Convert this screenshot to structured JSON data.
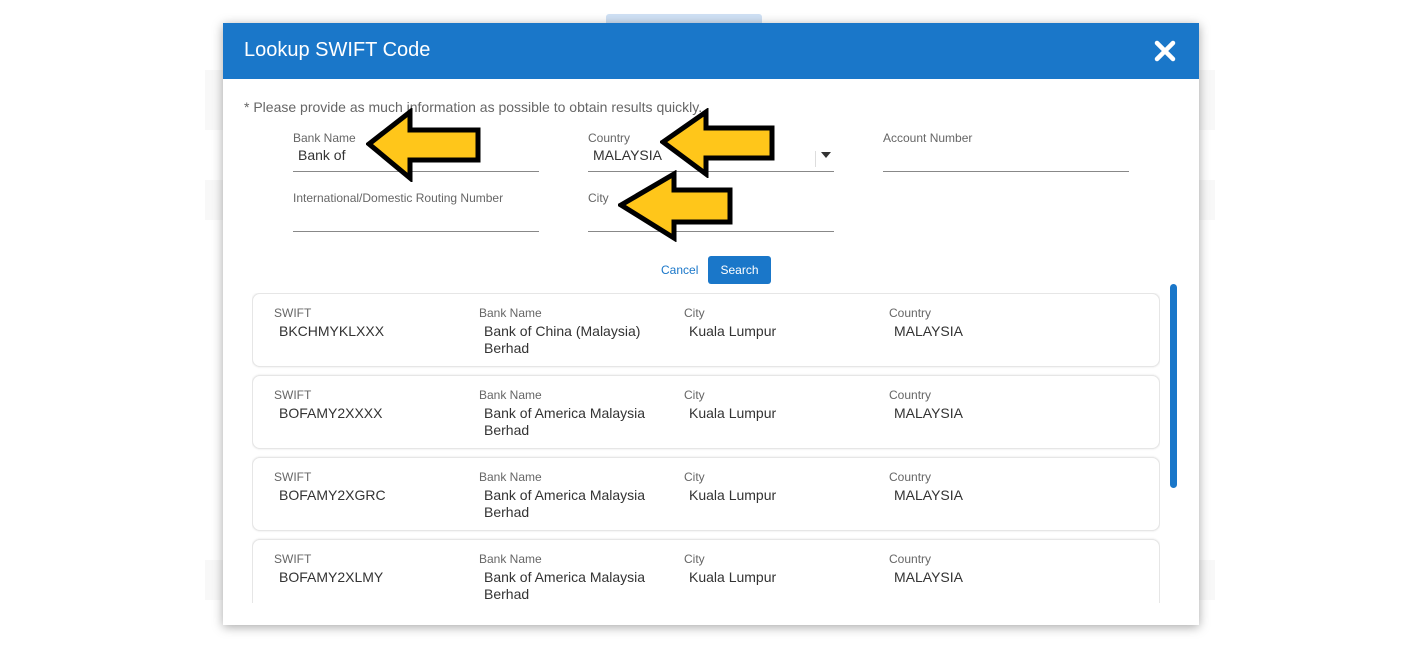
{
  "modal": {
    "title": "Lookup SWIFT Code",
    "hint": "* Please provide as much information as possible to obtain results quickly.",
    "fields": {
      "bank_name": {
        "label": "Bank Name",
        "value": "Bank of"
      },
      "country": {
        "label": "Country",
        "value": "MALAYSIA"
      },
      "account_number": {
        "label": "Account Number",
        "value": ""
      },
      "routing_number": {
        "label": "International/Domestic Routing Number",
        "value": ""
      },
      "city": {
        "label": "City",
        "value": ""
      }
    },
    "cancel_label": "Cancel",
    "search_label": "Search",
    "column_labels": {
      "swift": "SWIFT",
      "bank_name": "Bank Name",
      "city": "City",
      "country": "Country"
    },
    "results": [
      {
        "swift": "BKCHMYKLXXX",
        "bank_line1": "Bank of China (Malaysia)",
        "bank_line2": "Berhad",
        "city": "Kuala Lumpur",
        "country": "MALAYSIA"
      },
      {
        "swift": "BOFAMY2XXXX",
        "bank_line1": "Bank of America Malaysia",
        "bank_line2": "Berhad",
        "city": "Kuala Lumpur",
        "country": "MALAYSIA"
      },
      {
        "swift": "BOFAMY2XGRC",
        "bank_line1": "Bank of America Malaysia",
        "bank_line2": "Berhad",
        "city": "Kuala Lumpur",
        "country": "MALAYSIA"
      },
      {
        "swift": "BOFAMY2XLMY",
        "bank_line1": "Bank of America Malaysia",
        "bank_line2": "Berhad",
        "city": "Kuala Lumpur",
        "country": "MALAYSIA"
      }
    ]
  },
  "colors": {
    "accent": "#1a77c9",
    "arrow_fill": "#ffc61a",
    "arrow_stroke": "#000000"
  },
  "icons": {
    "close": "close-icon",
    "dropdown": "chevron-down-icon",
    "annotation": "arrow-left-icon"
  }
}
